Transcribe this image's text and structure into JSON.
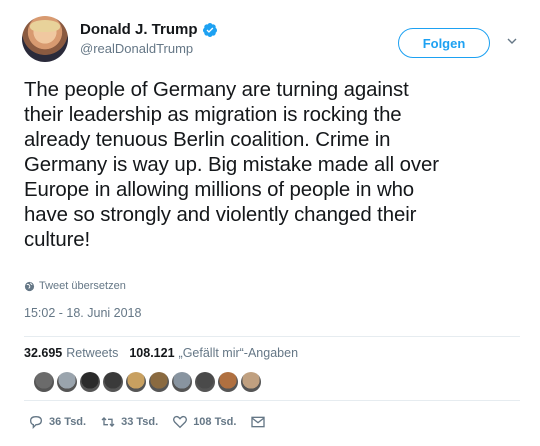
{
  "user": {
    "display_name": "Donald J. Trump",
    "handle": "@realDonaldTrump",
    "verified": true
  },
  "follow_label": "Folgen",
  "tweet": {
    "text": "The people of Germany are turning against\ntheir leadership as migration is rocking the\nalready tenuous Berlin coalition. Crime in\nGermany is way up. Big mistake made all over\nEurope in allowing millions of people in who\nhave so strongly and violently changed their\nculture!",
    "translate_label": "Tweet übersetzen",
    "timestamp": "15:02 - 18. Juni 2018"
  },
  "stats": {
    "retweets_count": "32.695",
    "retweets_label": "Retweets",
    "likes_count": "108.121",
    "likes_label": "„Gefällt mir“-Angaben"
  },
  "liker_avatars": [
    "#6b6b6b",
    "#9aa4ad",
    "#2b2b2b",
    "#3a3a3a",
    "#c8a060",
    "#8a6a40",
    "#8894a0",
    "#4a4a4a",
    "#b07040",
    "#c0a080"
  ],
  "actions": {
    "reply_count": "36 Tsd.",
    "retweet_count": "33 Tsd.",
    "like_count": "108 Tsd."
  },
  "colors": {
    "accent": "#1da1f2",
    "secondary_text": "#657786"
  }
}
